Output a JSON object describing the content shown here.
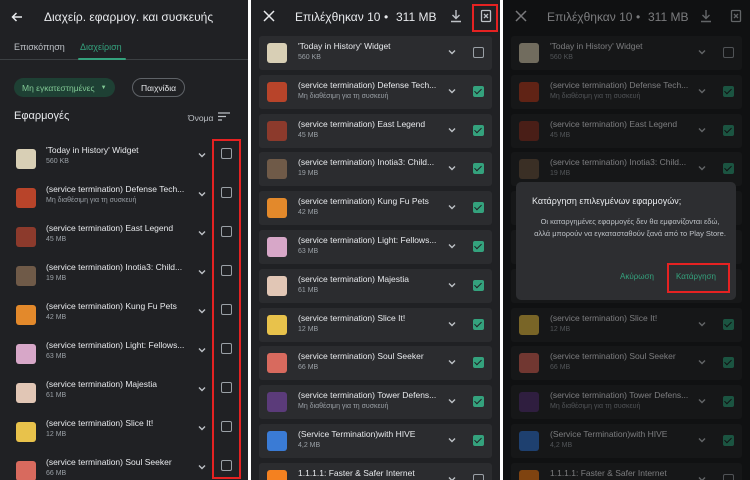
{
  "colors": {
    "accent": "#34a27d",
    "highlight": "#e52222",
    "bg": "#202124"
  },
  "panel1": {
    "title": "Διαχείρ. εφαρμογ. και συσκευής",
    "tabs": [
      "Επισκόπηση",
      "Διαχείριση"
    ],
    "active_tab": 1,
    "chip_filter": "Μη εγκατεστημένες",
    "chip_games": "Παιχνίδια",
    "section": "Εφαρμογές",
    "sort_label": "Όνομα",
    "apps": [
      {
        "name": "'Today in History' Widget",
        "meta": "560 KB",
        "color": "#d8cfb5"
      },
      {
        "name": "(service termination) Defense Tech...",
        "meta": "Μη διαθέσιμη για τη συσκευή",
        "color": "#b8442a"
      },
      {
        "name": "(service termination) East Legend",
        "meta": "45 MB",
        "color": "#8c3a2c"
      },
      {
        "name": "(service termination) Inotia3: Child...",
        "meta": "19 MB",
        "color": "#6f5a48"
      },
      {
        "name": "(service termination) Kung Fu Pets",
        "meta": "42 MB",
        "color": "#e3892b"
      },
      {
        "name": "(service termination) Light: Fellows...",
        "meta": "63 MB",
        "color": "#d7a7c8"
      },
      {
        "name": "(service termination) Majestia",
        "meta": "61 MB",
        "color": "#e1c6b5"
      },
      {
        "name": "(service termination) Slice It!",
        "meta": "12 MB",
        "color": "#e8c24b"
      },
      {
        "name": "(service termination) Soul Seeker",
        "meta": "66 MB",
        "color": "#d86a5e"
      }
    ]
  },
  "panel2": {
    "title": "Επιλέχθηκαν 10",
    "dot": "•",
    "size": "311 MB",
    "apps": [
      {
        "name": "'Today in History' Widget",
        "meta": "560 KB",
        "color": "#d8cfb5",
        "checked": false
      },
      {
        "name": "(service termination) Defense Tech...",
        "meta": "Μη διαθέσιμη για τη συσκευή",
        "color": "#b8442a",
        "checked": true
      },
      {
        "name": "(service termination) East Legend",
        "meta": "45 MB",
        "color": "#8c3a2c",
        "checked": true
      },
      {
        "name": "(service termination) Inotia3: Child...",
        "meta": "19 MB",
        "color": "#6f5a48",
        "checked": true
      },
      {
        "name": "(service termination) Kung Fu Pets",
        "meta": "42 MB",
        "color": "#e3892b",
        "checked": true
      },
      {
        "name": "(service termination) Light: Fellows...",
        "meta": "63 MB",
        "color": "#d7a7c8",
        "checked": true
      },
      {
        "name": "(service termination) Majestia",
        "meta": "61 MB",
        "color": "#e1c6b5",
        "checked": true
      },
      {
        "name": "(service termination) Slice It!",
        "meta": "12 MB",
        "color": "#e8c24b",
        "checked": true
      },
      {
        "name": "(service termination) Soul Seeker",
        "meta": "66 MB",
        "color": "#d86a5e",
        "checked": true
      },
      {
        "name": "(service termination) Tower Defens...",
        "meta": "Μη διαθέσιμη για τη συσκευή",
        "color": "#5b3b7a",
        "checked": true
      },
      {
        "name": "(Service Termination)with HIVE",
        "meta": "4,2 MB",
        "color": "#3a7bd5",
        "checked": true
      },
      {
        "name": "1.1.1.1: Faster & Safer Internet",
        "meta": "",
        "color": "#f48120",
        "checked": false
      }
    ]
  },
  "panel3": {
    "title": "Επιλέχθηκαν 10",
    "dot": "•",
    "size": "311 MB",
    "dialog": {
      "title": "Κατάργηση επιλεγμένων εφαρμογών;",
      "body": "Οι καταργημένες εφαρμογές δεν θα εμφανίζονται εδώ, αλλά μπορούν να εγκατασταθούν ξανά από το Play Store.",
      "cancel": "Ακύρωση",
      "confirm": "Κατάργηση"
    }
  }
}
